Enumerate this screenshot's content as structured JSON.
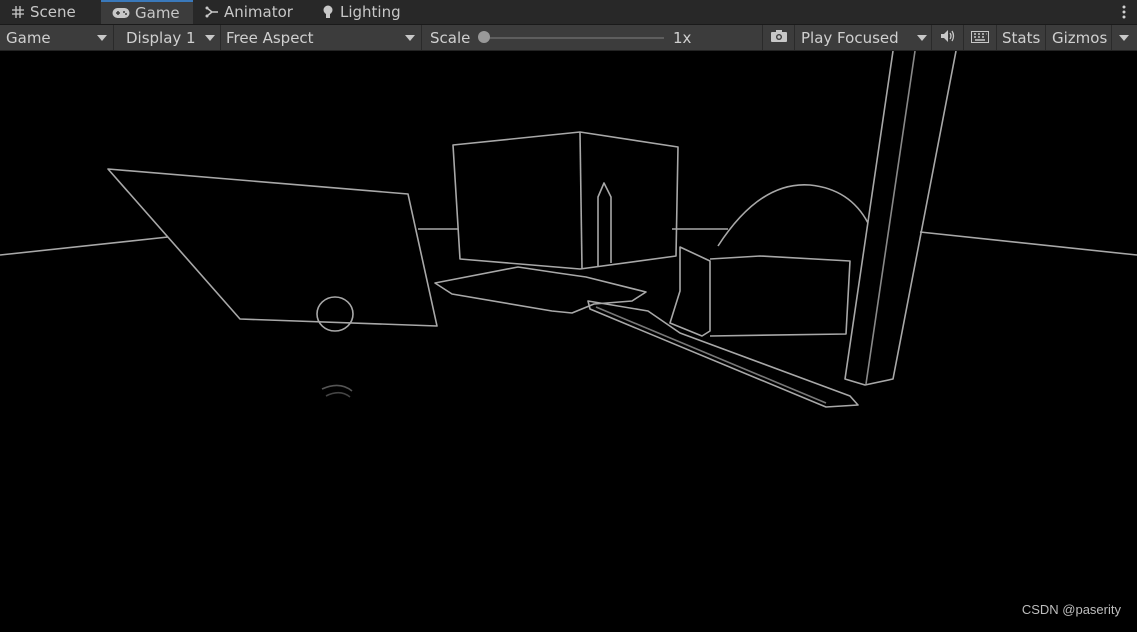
{
  "tabs": [
    {
      "label": "Scene",
      "icon": "grid-icon",
      "active": false
    },
    {
      "label": "Game",
      "icon": "gamepad-icon",
      "active": true
    },
    {
      "label": "Animator",
      "icon": "animator-icon",
      "active": false
    },
    {
      "label": "Lighting",
      "icon": "lightbulb-icon",
      "active": false
    }
  ],
  "toolbar": {
    "view_mode": "Game",
    "display": "Display 1",
    "aspect": "Free Aspect",
    "scale_label": "Scale",
    "scale_value": "1x",
    "scale_level": 0,
    "play_mode": "Play Focused",
    "stats_label": "Stats",
    "gizmos_label": "Gizmos"
  },
  "viewport": {
    "watermark": "CSDN @paserity",
    "background": "#000000",
    "line_color": "#b8b8b8"
  },
  "colors": {
    "tab_accent": "#3a79bb",
    "toolbar_bg": "#3c3c3c",
    "tabbar_bg": "#282828"
  }
}
